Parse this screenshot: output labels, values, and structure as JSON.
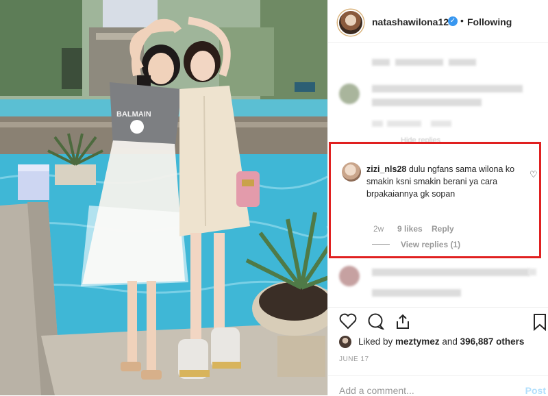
{
  "post": {
    "username": "natashawilona12",
    "verified_icon": "verified-badge-icon",
    "separator": "•",
    "follow_status": "Following"
  },
  "blurred": {
    "hide_replies": "Hide replies"
  },
  "highlighted_comment": {
    "username": "zizi_nls28",
    "text": "dulu ngfans sama wilona ko smakin ksni smakin berani ya cara brpakaiannya gk sopan",
    "age": "2w",
    "likes": "9 likes",
    "reply": "Reply",
    "view_replies": "View replies (1)",
    "border_color": "#e02020"
  },
  "likes": {
    "prefix": "Liked by ",
    "user": "meztymez",
    "middle": " and ",
    "count": "396,887 others"
  },
  "date": "JUNE 17",
  "comment_box": {
    "placeholder": "Add a comment...",
    "post_label": "Post"
  },
  "colors": {
    "accent": "#3897f0",
    "muted": "#999999",
    "pool": "#3fb7d6"
  }
}
